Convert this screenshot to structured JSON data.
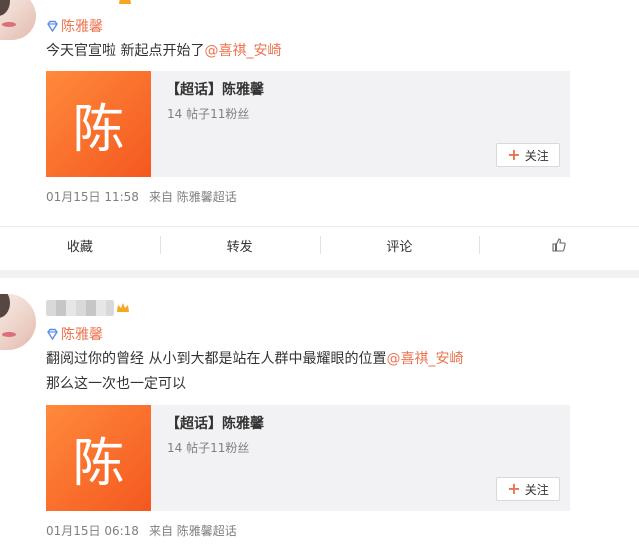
{
  "posts": [
    {
      "tag": "陈雅馨",
      "text_main": "今天官宣啦 新起点开始了",
      "mention": "@喜祺_安崎",
      "text_line2": "",
      "card": {
        "thumb_char": "陈",
        "title": "【超话】陈雅馨",
        "sub": "14 帖子11粉丝",
        "follow": "关注"
      },
      "meta": {
        "date": "01月15日 11:58",
        "source": "来自 陈雅馨超话"
      },
      "actions": [
        "收藏",
        "转发",
        "评论"
      ]
    },
    {
      "tag": "陈雅馨",
      "text_main": "翻阅过你的曾经 从小到大都是站在人群中最耀眼的位置",
      "mention": "@喜祺_安崎",
      "text_line2": "那么这一次也一定可以",
      "card": {
        "thumb_char": "陈",
        "title": "【超话】陈雅馨",
        "sub": "14 帖子11粉丝",
        "follow": "关注"
      },
      "meta": {
        "date": "01月15日 06:18",
        "source": "来自 陈雅馨超话"
      }
    }
  ],
  "colors": {
    "accent": "#eb7350",
    "card_bg": "#f2f2f5",
    "thumb": "#f4581f"
  }
}
